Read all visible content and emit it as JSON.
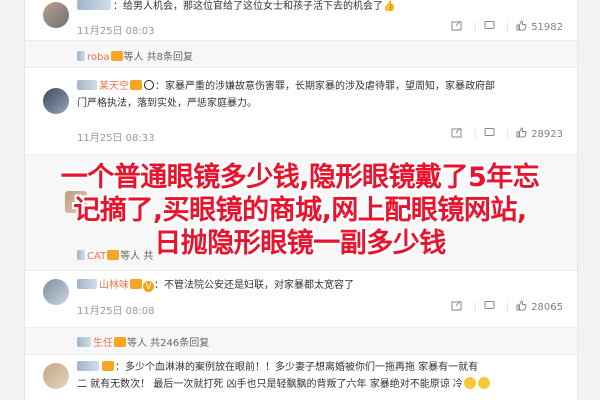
{
  "comments": [
    {
      "text": "：给男人机会，那这位官给了这位女士和孩子活下去的机会了👍",
      "time": "11月25日 08:03",
      "likes": "51982"
    },
    {
      "sub_user": "roba",
      "sub_text": "等人 共8条回复"
    },
    {
      "user": "某天空",
      "text_line1": "：家暴严重的涉嫌故意伤害罪，长期家暴的涉及虐待罪，望周知，家暴政府部",
      "text_line2": "门严格执法，落到实处，严惩家庭暴力。",
      "time": "11月25日 08:33",
      "likes": "28923"
    },
    {
      "sub_user": "CAT",
      "sub_text": "等人 共"
    },
    {
      "user": "山林味",
      "text": "：不管法院公安还是妇联，对家暴都太宽容了",
      "time": "11月25日 08:08",
      "likes": "28065"
    },
    {
      "sub_user": "生任",
      "sub_text": "等人 共246条回复"
    },
    {
      "text_line1": "：多少个血淋淋的案例放在眼前！！多少妻子想离婚被你们一拖再拖 家暴有一就有",
      "text_line2": "二 就有无数次！  最后一次就打死  凶手也只是轻飘飘的背叛了六年  家暴绝对不能原谅 冷"
    }
  ],
  "overlay": {
    "line1": "一个普通眼镜多少钱,隐形眼镜戴了5年忘",
    "line2": "记摘了,买眼镜的商城,网上配眼镜网站,",
    "line3": "日抛隐形眼镜一副多少钱"
  },
  "colors": {
    "overlay_text": "#e8142d",
    "username": "#eb7350"
  }
}
